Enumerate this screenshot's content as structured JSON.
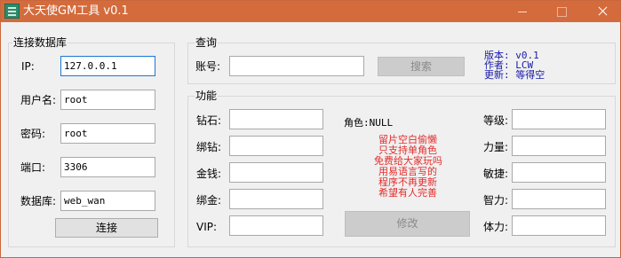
{
  "window": {
    "title": "大天使GM工具 v0.1",
    "icon": "app-icon",
    "controls": [
      "minimize-icon",
      "maximize-icon",
      "close-icon"
    ]
  },
  "connection": {
    "title": "连接数据库",
    "fields": {
      "ip": {
        "label": "IP:",
        "value": "127.0.0.1"
      },
      "username": {
        "label": "用户名:",
        "value": "root"
      },
      "password": {
        "label": "密码:",
        "value": "root"
      },
      "port": {
        "label": "端口:",
        "value": "3306"
      },
      "database": {
        "label": "数据库:",
        "value": "web_wan"
      }
    },
    "connect_label": "连接"
  },
  "query": {
    "title": "查询",
    "account_label": "账号:",
    "account_value": "",
    "search_label": "搜索"
  },
  "about": {
    "version": "版本: v0.1",
    "author": "作者: LCW",
    "update": "更新: 等得空"
  },
  "functions": {
    "title": "功能",
    "left": [
      {
        "label": "钻石:",
        "value": ""
      },
      {
        "label": "绑钻:",
        "value": ""
      },
      {
        "label": "金钱:",
        "value": ""
      },
      {
        "label": "绑金:",
        "value": ""
      },
      {
        "label": "VIP:",
        "value": ""
      }
    ],
    "right": [
      {
        "label": "等级:",
        "value": ""
      },
      {
        "label": "力量:",
        "value": ""
      },
      {
        "label": "敏捷:",
        "value": ""
      },
      {
        "label": "智力:",
        "value": ""
      },
      {
        "label": "体力:",
        "value": ""
      }
    ],
    "role_label": "角色:NULL",
    "notice": [
      "留片空白偷懒",
      "只支持单角色",
      "免费给大家玩吗",
      "用易语言写的",
      "程序不再更新",
      "希望有人完善"
    ],
    "modify_label": "修改"
  },
  "colors": {
    "titlebar": "#d46b3c",
    "info_text": "#1a1aa8",
    "notice_text": "#e42b2b",
    "focus_border": "#1a77d5"
  }
}
